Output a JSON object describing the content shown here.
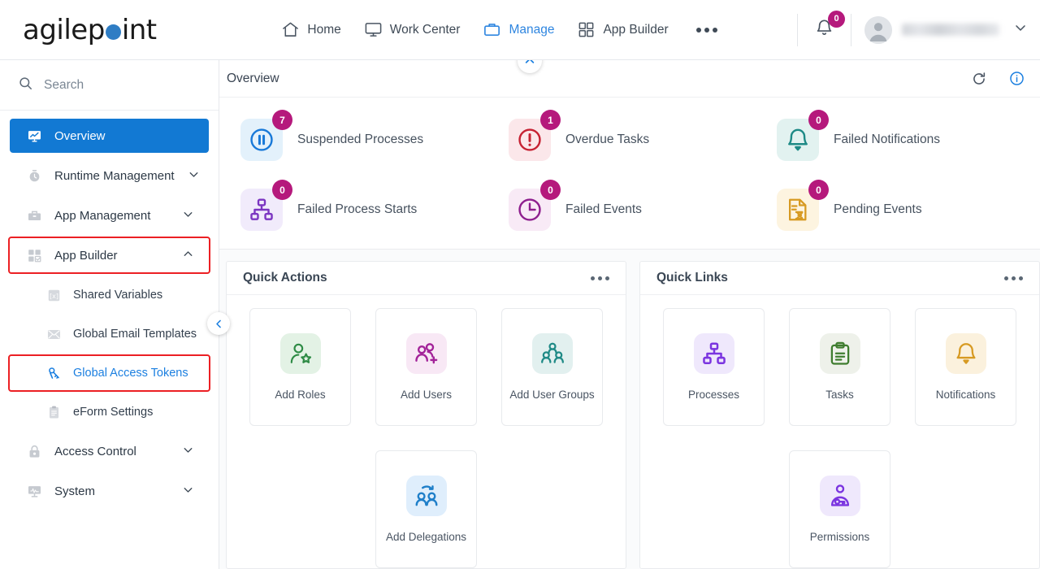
{
  "header": {
    "logo_text_before": "agilep",
    "logo_text_after": "int",
    "nav": [
      {
        "label": "Home",
        "icon": "home-icon",
        "active": false
      },
      {
        "label": "Work Center",
        "icon": "monitor-icon",
        "active": false
      },
      {
        "label": "Manage",
        "icon": "briefcase-icon",
        "active": true
      },
      {
        "label": "App Builder",
        "icon": "grid-icon",
        "active": false
      }
    ],
    "more_label": "More",
    "notification_count": "0",
    "user_name": ""
  },
  "sidebar": {
    "search_placeholder": "Search",
    "search_value": "",
    "items": [
      {
        "label": "Overview",
        "icon": "dashboard-icon",
        "state": "active",
        "level": "top",
        "chevron": ""
      },
      {
        "label": "Runtime Management",
        "icon": "clock-icon",
        "state": "normal",
        "level": "top",
        "chevron": "down"
      },
      {
        "label": "App Management",
        "icon": "toolbox-icon",
        "state": "normal",
        "level": "top",
        "chevron": "down"
      },
      {
        "label": "App Builder",
        "icon": "grid-check-icon",
        "state": "highlighted",
        "level": "top",
        "chevron": "up"
      },
      {
        "label": "Shared Variables",
        "icon": "variable-icon",
        "state": "normal",
        "level": "sub",
        "chevron": ""
      },
      {
        "label": "Global Email Templates",
        "icon": "envelope-icon",
        "state": "normal",
        "level": "sub",
        "chevron": ""
      },
      {
        "label": "Global Access Tokens",
        "icon": "key-icon",
        "state": "highlighted-link",
        "level": "sub",
        "chevron": ""
      },
      {
        "label": "eForm Settings",
        "icon": "clipboard-icon",
        "state": "normal",
        "level": "sub",
        "chevron": ""
      },
      {
        "label": "Access Control",
        "icon": "lock-icon",
        "state": "normal",
        "level": "top",
        "chevron": "down"
      },
      {
        "label": "System",
        "icon": "system-monitor-icon",
        "state": "normal",
        "level": "top",
        "chevron": "down"
      }
    ]
  },
  "overview": {
    "title": "Overview",
    "refresh_icon": "refresh-icon",
    "info_icon": "info-icon",
    "tiles": [
      {
        "label": "Suspended Processes",
        "count": "7",
        "icon": "pause-circle-icon",
        "bg": "#e3f1fb",
        "color": "#1879d8"
      },
      {
        "label": "Overdue Tasks",
        "count": "1",
        "icon": "exclamation-circle-icon",
        "bg": "#fbe7ea",
        "color": "#c62233"
      },
      {
        "label": "Failed Notifications",
        "count": "0",
        "icon": "bell-icon",
        "bg": "#e2f2f0",
        "color": "#1e8a86"
      },
      {
        "label": "Failed Process Starts",
        "count": "0",
        "icon": "hierarchy-icon",
        "bg": "#f1ebfb",
        "color": "#7b35c1"
      },
      {
        "label": "Failed Events",
        "count": "0",
        "icon": "clock-circle-icon",
        "bg": "#f8eaf6",
        "color": "#8e1f8e"
      },
      {
        "label": "Pending Events",
        "count": "0",
        "icon": "document-hourglass-icon",
        "bg": "#fdf4e0",
        "color": "#d79a22"
      }
    ]
  },
  "quick_actions": {
    "title": "Quick Actions",
    "menu_icon": "more-dots-icon",
    "cards": [
      {
        "label": "Add Roles",
        "icon": "person-star-icon",
        "bg": "#e3f2e5",
        "color": "#2e8b45"
      },
      {
        "label": "Add Users",
        "icon": "people-plus-icon",
        "bg": "#f8e8f5",
        "color": "#a32399"
      },
      {
        "label": "Add User Groups",
        "icon": "people-group-icon",
        "bg": "#e2f0ef",
        "color": "#1f8a86"
      },
      {
        "label": "Add Delegations",
        "icon": "people-arrow-icon",
        "bg": "#dfeefc",
        "color": "#1f7fc9"
      }
    ]
  },
  "quick_links": {
    "title": "Quick Links",
    "menu_icon": "more-dots-icon",
    "cards": [
      {
        "label": "Processes",
        "icon": "hierarchy-icon",
        "bg": "#efe8fc",
        "color": "#7b35e0"
      },
      {
        "label": "Tasks",
        "icon": "clipboard-check-icon",
        "bg": "#eef1ea",
        "color": "#3f7d2f"
      },
      {
        "label": "Notifications",
        "icon": "bell-icon",
        "bg": "#fbf1dd",
        "color": "#d79a22"
      },
      {
        "label": "Permissions",
        "icon": "person-key-icon",
        "bg": "#efe8fc",
        "color": "#7b35e0"
      }
    ]
  },
  "colors": {
    "accent_blue": "#1279d3",
    "badge_magenta": "#b5197c",
    "highlight_red": "#ec2024",
    "logo_blue": "#2f7dc4"
  }
}
